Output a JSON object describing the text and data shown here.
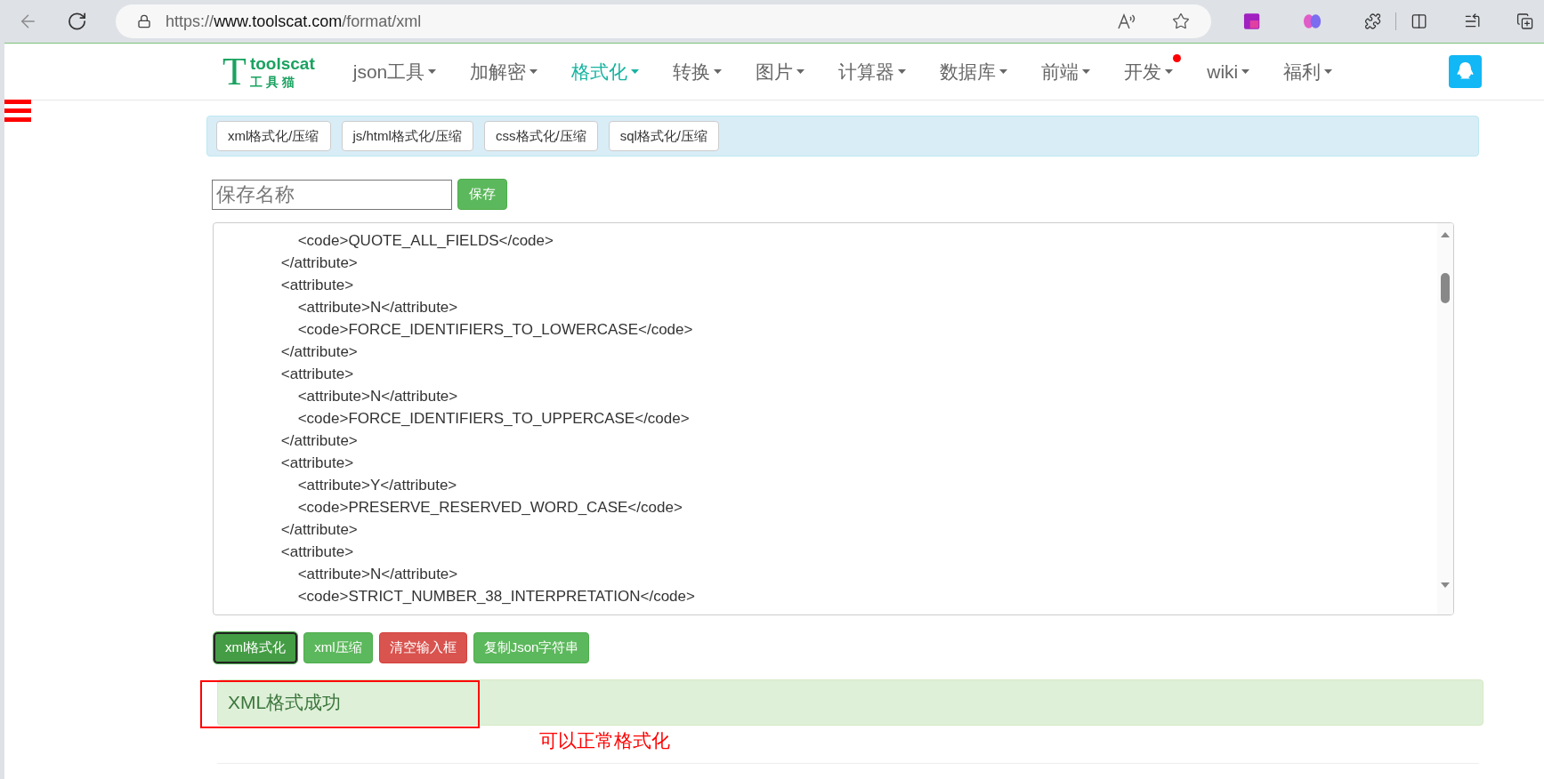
{
  "browser": {
    "url_scheme": "https://",
    "url_host": "www.toolscat.com",
    "url_path": "/format/xml"
  },
  "logo": {
    "letter": "T",
    "name": "toolscat",
    "subtitle": "工 具 猫"
  },
  "nav": [
    {
      "label": "json工具",
      "selected": false,
      "badge": false
    },
    {
      "label": "加解密",
      "selected": false,
      "badge": false
    },
    {
      "label": "格式化",
      "selected": true,
      "badge": false
    },
    {
      "label": "转换",
      "selected": false,
      "badge": false
    },
    {
      "label": "图片",
      "selected": false,
      "badge": false
    },
    {
      "label": "计算器",
      "selected": false,
      "badge": false
    },
    {
      "label": "数据库",
      "selected": false,
      "badge": false
    },
    {
      "label": "前端",
      "selected": false,
      "badge": false
    },
    {
      "label": "开发",
      "selected": false,
      "badge": true
    },
    {
      "label": "wiki",
      "selected": false,
      "badge": false
    },
    {
      "label": "福利",
      "selected": false,
      "badge": false
    }
  ],
  "subtabs": [
    "xml格式化/压缩",
    "js/html格式化/压缩",
    "css格式化/压缩",
    "sql格式化/压缩"
  ],
  "save": {
    "placeholder": "保存名称",
    "button": "保存"
  },
  "editor_lines": [
    "            <code>QUOTE_ALL_FIELDS</code>",
    "        </attribute>",
    "        <attribute>",
    "            <attribute>N</attribute>",
    "            <code>FORCE_IDENTIFIERS_TO_LOWERCASE</code>",
    "        </attribute>",
    "        <attribute>",
    "            <attribute>N</attribute>",
    "            <code>FORCE_IDENTIFIERS_TO_UPPERCASE</code>",
    "        </attribute>",
    "        <attribute>",
    "            <attribute>Y</attribute>",
    "            <code>PRESERVE_RESERVED_WORD_CASE</code>",
    "        </attribute>",
    "        <attribute>",
    "            <attribute>N</attribute>",
    "            <code>STRICT_NUMBER_38_INTERPRETATION</code>"
  ],
  "actions": [
    {
      "label": "xml格式化",
      "kind": "active"
    },
    {
      "label": "xml压缩",
      "kind": "success"
    },
    {
      "label": "清空输入框",
      "kind": "danger"
    },
    {
      "label": "复制Json字符串",
      "kind": "success"
    }
  ],
  "result": {
    "message": "XML格式成功",
    "annotation": "可以正常格式化"
  }
}
